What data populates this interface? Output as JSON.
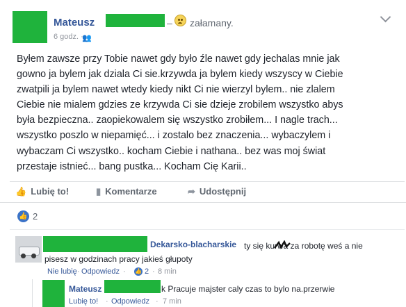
{
  "colors": {
    "censor": "#1fb33c",
    "link": "#365899",
    "muted": "#90949c",
    "like_blue": "#3b73c8"
  },
  "post": {
    "author": "Mateusz",
    "feeling_dash": "–",
    "feeling": "załamany.",
    "time": "6 godz. ·",
    "audience_icon": "friends-icon",
    "text": "Byłem zawsze przy Tobie nawet gdy było źle nawet gdy jechalas mnie jak\ngowno ja bylem jak dziala Ci sie.krzywda ja bylem kiedy wszyscy w Ciebie\nzwatpili ja bylem nawet wtedy kiedy nikt Ci nie wierzyl bylem.. nie zlalem\nCiebie nie mialem gdzies ze krzywda Ci sie dzieje zrobilem wszystko abys\nbyła bezpieczna.. zaopiekowalem się wszystko zrobiłem... I nagle trach...\nwszystko poszlo w niepamięć... i zostalo bez znaczenia... wybaczylem i\nwybaczam Ci wszystko.. kocham Ciebie i nathana.. bez was moj świat\nprzestaje istnieć... bang pustka... Kocham Cię Karii..",
    "actions": {
      "like": "Lubię to!",
      "comment": "Komentarze",
      "share": "Udostępnij"
    },
    "reaction_count": "2"
  },
  "comments": [
    {
      "author": "Dekarsko-blacharskie",
      "text": "ty się kurwa za robotę weś a nie pisesz w godzinach pracy jakieś głupoty",
      "unlike": "Nie lubię",
      "sep": "·",
      "reply": "Odpowiedz",
      "likes": "2",
      "time": "8 min"
    }
  ],
  "reply": {
    "author": "Mateusz",
    "text": "k Pracuje majster caly czas to bylo na.przerwie",
    "like": "Lubię to!",
    "sep": "·",
    "reply": "Odpowiedz",
    "time": "7 min"
  }
}
